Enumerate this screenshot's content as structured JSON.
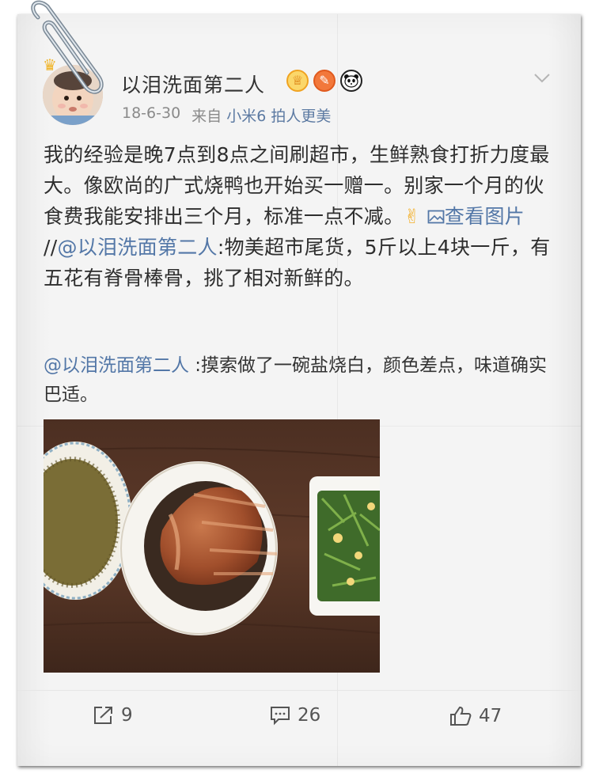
{
  "post": {
    "username": "以泪洗面第二人",
    "time": "18-6-30",
    "from_label": "来自",
    "source": "小米6 拍人更美",
    "text_part1": "我的经验是晚7点到8点之间刷超市，生鲜熟食打折力度最大。像欧尚的广式烧鸭也开始买一赠一。别家一个月的伙食费我能安排出三个月，标准一点不减。",
    "text_emoji": "✌",
    "view_image_label": "查看图片",
    "repost_separator": " //",
    "repost_mention": "@以泪洗面第二人",
    "text_part2": ":物美超市尾货，5斤以上4块一斤，有五花有脊骨棒骨，挑了相对新鲜的。",
    "repost_user": "@以泪洗面第二人",
    "repost_text": " :摸索做了一碗盐烧白，颜色差点，味道确实巴适。"
  },
  "badges": {
    "crown": "crown-badge-icon",
    "feather": "feather-badge-icon",
    "panda": "panda-badge-icon"
  },
  "actions": {
    "share_count": "9",
    "comment_count": "26",
    "like_count": "47"
  },
  "colors": {
    "link": "#5377a7",
    "text": "#2e2e2e",
    "meta": "#8a8a8a",
    "paper": "#f4f4f4"
  }
}
